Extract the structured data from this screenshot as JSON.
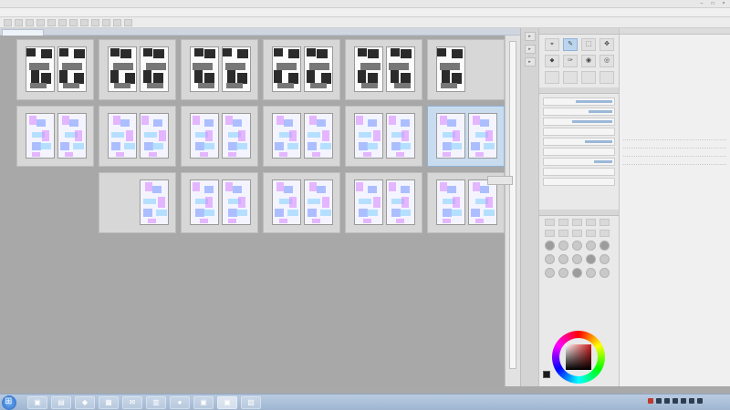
{
  "window": {
    "title": "",
    "controls": [
      "–",
      "□",
      "×"
    ]
  },
  "menubar": {
    "items": [
      "",
      "",
      "",
      "",
      "",
      "",
      "",
      "",
      "",
      ""
    ]
  },
  "toolbar": {
    "buttons": [
      "",
      "",
      "",
      "",
      "",
      "",
      "",
      "",
      "",
      "",
      "",
      ""
    ]
  },
  "document_tab": {
    "label": ""
  },
  "pages": {
    "row1": [
      {
        "left": "",
        "right": "",
        "style": "mono"
      },
      {
        "left": "",
        "right": "",
        "style": "mono"
      },
      {
        "left": "",
        "right": "",
        "style": "mono"
      },
      {
        "left": "",
        "right": "",
        "style": "mono"
      },
      {
        "left": "",
        "right": "",
        "style": "mono"
      },
      {
        "left": "",
        "right": "",
        "style": "mono-single"
      }
    ],
    "row2": [
      {
        "left": "",
        "right": "",
        "style": "sketch"
      },
      {
        "left": "",
        "right": "",
        "style": "sketch"
      },
      {
        "left": "",
        "right": "",
        "style": "sketch"
      },
      {
        "left": "",
        "right": "",
        "style": "sketch"
      },
      {
        "left": "",
        "right": "",
        "style": "sketch"
      },
      {
        "left": "",
        "right": "",
        "style": "sketch",
        "selected": true
      }
    ],
    "row3": [
      {
        "left": "",
        "right": "",
        "style": "sketch-single"
      },
      {
        "left": "",
        "right": "",
        "style": "sketch"
      },
      {
        "left": "",
        "right": "",
        "style": "sketch"
      },
      {
        "left": "",
        "right": "",
        "style": "sketch"
      },
      {
        "left": "",
        "right": "",
        "style": "sketch"
      }
    ]
  },
  "tooltip": {
    "text": ""
  },
  "tool_panel": {
    "header": "",
    "tools": [
      "⌖",
      "✎",
      "⬚",
      "✥",
      "⬥",
      "✑",
      "◉",
      "◎",
      "",
      "",
      "",
      ""
    ],
    "active_tool_index": 1
  },
  "property_panel": {
    "header": "",
    "rows": [
      "",
      "",
      "",
      "",
      "",
      "",
      "",
      "",
      ""
    ]
  },
  "brush_panel": {
    "header": "",
    "square_count": 10,
    "dot_count": 15
  },
  "color": {
    "main": "#1a1a1a",
    "hue": "#d11a1a"
  },
  "layer_panel": {
    "header": "",
    "rows": [
      "",
      "",
      "",
      ""
    ]
  },
  "taskbar": {
    "apps": [
      "▣",
      "▤",
      "◆",
      "▦",
      "✉",
      "▥",
      "●",
      "▣",
      "▣",
      "▧"
    ],
    "active_index": 8,
    "clock_time": "",
    "clock_date": ""
  }
}
